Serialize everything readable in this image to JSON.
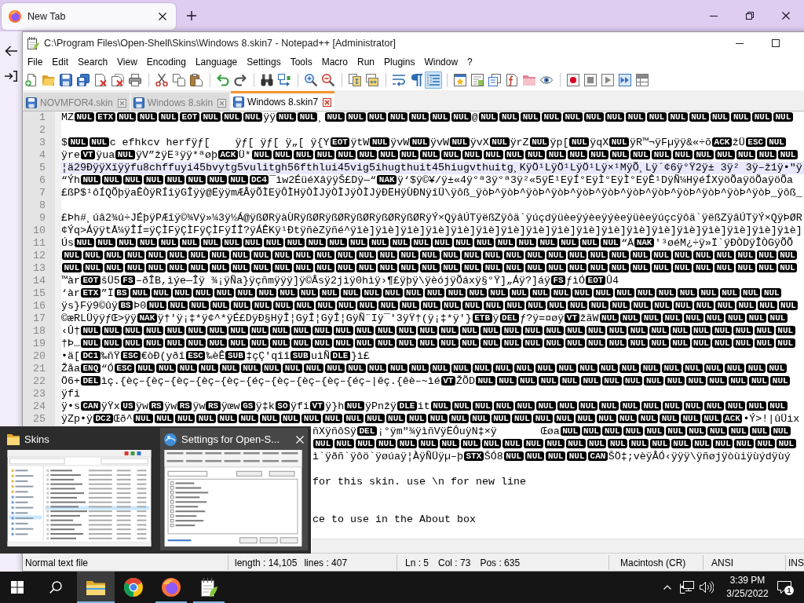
{
  "browser": {
    "tabs": [
      {
        "label": "New Tab",
        "selected": true
      }
    ]
  },
  "notepad": {
    "title": "C:\\Program Files\\Open-Shell\\Skins\\Windows 8.skin7 - Notepad++ [Administrator]",
    "menu": [
      "File",
      "Edit",
      "Search",
      "View",
      "Encoding",
      "Language",
      "Settings",
      "Tools",
      "Macro",
      "Run",
      "Plugins",
      "Window",
      "?"
    ],
    "toolbar": [
      [
        {
          "kind": "new",
          "on": false
        },
        {
          "kind": "open",
          "on": false
        },
        {
          "kind": "save",
          "on": false
        },
        {
          "kind": "save_all",
          "on": false
        },
        {
          "kind": "close",
          "on": false
        },
        {
          "kind": "close_all",
          "on": false
        },
        {
          "kind": "print",
          "on": false
        }
      ],
      [
        {
          "kind": "cut",
          "on": false
        },
        {
          "kind": "copy",
          "on": false
        },
        {
          "kind": "paste",
          "on": false
        }
      ],
      [
        {
          "kind": "undo",
          "on": false
        },
        {
          "kind": "redo",
          "on": false
        }
      ],
      [
        {
          "kind": "find",
          "on": false
        },
        {
          "kind": "replace",
          "on": false
        }
      ],
      [
        {
          "kind": "zoom_in",
          "on": false
        },
        {
          "kind": "zoom_out",
          "on": false
        }
      ],
      [
        {
          "kind": "sync_v",
          "on": false
        },
        {
          "kind": "sync_h",
          "on": false
        }
      ],
      [
        {
          "kind": "wrap",
          "on": false
        },
        {
          "kind": "all_chars",
          "on": false
        },
        {
          "kind": "indent_guide",
          "on": true
        }
      ],
      [
        {
          "kind": "udl",
          "on": false
        },
        {
          "kind": "doc_map",
          "on": false
        },
        {
          "kind": "doc_list",
          "on": false
        },
        {
          "kind": "function_list",
          "on": false
        },
        {
          "kind": "workspace",
          "on": false
        },
        {
          "kind": "monitor",
          "on": false
        }
      ],
      [
        {
          "kind": "record",
          "on": false
        },
        {
          "kind": "stop",
          "on": false
        },
        {
          "kind": "play",
          "on": false
        },
        {
          "kind": "play_multi",
          "on": false
        },
        {
          "kind": "save_macro",
          "on": false
        }
      ]
    ],
    "tabs": [
      {
        "label": "NOVMFOR4.skin",
        "selected": false
      },
      {
        "label": "Windows 8.skin",
        "selected": false
      },
      {
        "label": "Windows 8.skin7",
        "selected": true
      }
    ],
    "editor": {
      "lines": [
        {
          "number": "1",
          "current": false,
          "segments": [
            {
              "text": "MZ"
            },
            {
              "controls": [
                "NUL",
                "ETX",
                "NUL",
                "NUL",
                "NUL",
                "EOT",
                "NUL",
                "NUL",
                "NUL"
              ]
            },
            {
              "text": "ÿÿ"
            },
            {
              "controls": [
                "NUL",
                "NUL"
              ]
            },
            {
              "text": "¸"
            },
            {
              "controls": [
                "NUL",
                "NUL",
                "NUL",
                "NUL",
                "NUL",
                "NUL",
                "NUL"
              ]
            },
            {
              "text": "@"
            },
            {
              "controls": [
                "NUL",
                "NUL",
                "NUL",
                "NUL",
                "NUL",
                "NUL",
                "NUL",
                "NUL",
                "NUL",
                "NUL",
                "NUL",
                "NUL",
                "NUL",
                "NUL",
                "NUL"
              ]
            }
          ]
        },
        {
          "number": "2",
          "current": false
        },
        {
          "number": "3",
          "current": false,
          "segments": [
            {
              "text": "$"
            },
            {
              "controls": [
                "NUL",
                "NUL"
              ]
            },
            {
              "text": "c efhkcv herfÿƒ[    ÿƒ[ ÿƒ[ ÿ„[ ÿ{Y"
            },
            {
              "controls": [
                "EOT"
              ]
            },
            {
              "text": "ÿtW"
            },
            {
              "controls": [
                "NUL"
              ]
            },
            {
              "text": "ÿvW"
            },
            {
              "controls": [
                "NUL"
              ]
            },
            {
              "text": "ÿvW"
            },
            {
              "controls": [
                "NUL"
              ]
            },
            {
              "text": "ÿvX"
            },
            {
              "controls": [
                "NUL"
              ]
            },
            {
              "text": "ÿrZ"
            },
            {
              "controls": [
                "NUL"
              ]
            },
            {
              "text": "ÿp["
            },
            {
              "controls": [
                "NUL"
              ]
            },
            {
              "text": "ÿqX"
            },
            {
              "controls": [
                "NUL"
              ]
            },
            {
              "text": "ÿR™¬ÿFµÿÿ&«÷õ"
            },
            {
              "controls": [
                "ACK"
              ]
            },
            {
              "text": "žÜ"
            },
            {
              "controls": [
                "ESC",
                "NUL"
              ]
            }
          ]
        },
        {
          "number": "4",
          "current": false,
          "segments": [
            {
              "text": "ÿre"
            },
            {
              "controls": [
                "VT"
              ]
            },
            {
              "text": "ÿua"
            },
            {
              "controls": [
                "NUL"
              ]
            },
            {
              "text": "ÿV”žÿE³ÿÿ*ªøþ"
            },
            {
              "controls": [
                "ACK"
              ]
            },
            {
              "text": "Ü*"
            },
            {
              "controls": [
                "NUL",
                "NUL",
                "NUL",
                "NUL",
                "NUL",
                "NUL",
                "NUL",
                "NUL",
                "NUL",
                "NUL",
                "NUL",
                "NUL",
                "NUL",
                "NUL",
                "NUL",
                "NUL",
                "NUL",
                "NUL",
                "NUL",
                "NUL",
                "NUL",
                "NUL",
                "NUL",
                "NUL",
                "NUL",
                "NUL"
              ]
            }
          ]
        },
        {
          "number": "5",
          "current": true,
          "segments": [
            {
              "text": "¦ä29ÐÿÿXïÿÿfu8chffuyi45bvytg5vulitgh56fthlui45vig5ihugthuit45hiugvthuitg¸KÿÖ¹LÿÖ¹LÿÖ¹Lÿ×¹MÿÕ¸Lÿ´¢6ÿ°Ÿ2ÿ± 3ÿ² 3ÿ–ž1ÿ•\"ÿ"
            }
          ]
        },
        {
          "number": "6",
          "current": false,
          "segments": [
            {
              "text": "“Ýh"
            },
            {
              "controls": [
                "NUL",
                "NUL",
                "NUL",
                "NUL",
                "NUL",
                "NUL",
                "NUL",
                "NUL",
                "DC4"
              ]
            },
            {
              "text": "¯ìw2ÉüéXâÿÿŠ£Dÿ—“"
            },
            {
              "controls": [
                "NAK"
              ]
            },
            {
              "text": "ÿ‘$ÿ©¥/ÿ±«4ÿ°ª3ÿ°ª3ÿ²«5ÿË¹EÿÍ°EÿÌ°EÿÌ°EÿÊ¹DÿÑ¼HÿéÍXÿöÕaÿöÕaÿöÕa"
            }
          ]
        },
        {
          "number": "7",
          "current": false,
          "segments": [
            {
              "text": "£ßP$¹ôÍQÕþÿaÊÒÿRÍîÿGÎÿÿ@ËÿÿmÆÂÿÕÌEÿÔÌHÿÒÌJÿÒÌJÿÒÌJÿÐËHÿÙÐNÿîÜ\\ÿôß_ÿòÞ^ÿòÞ^ÿòÞ^ÿòÞ^ÿòÞ^ÿòÞ^ÿòÞ^ÿòÞ^ÿòÞ^ÿòÞ^ÿòÞ^ÿòÞ_ÿôß_"
            }
          ]
        },
        {
          "number": "8",
          "current": false
        },
        {
          "number": "9",
          "current": false,
          "segments": [
            {
              "text": "£Þh#¸úâ2¾ú÷JÉþÿPÆîÿ©¾Vÿ»¼3ÿ½Á@ÿßØRÿàÙRÿßØRÿßØRÿßØRÿßØRÿßØRÿÝ×QÿâÚTÿëßZÿôä`ÿúçdÿüèeÿýèeÿýèeÿüèeÿúçcÿôä`ÿëßZÿâÚTÿÝ×QÿÞØR"
            }
          ]
        },
        {
          "number": "10",
          "current": false,
          "segments": [
            {
              "text": "¢Ýq>ÁÿÿtÅ¼ÿÎÍ=ÿÇÌFÿÇÌFÿÇÌFÿÍÎ?ÿÁÊKÿ¹ÐtÿñèZÿñé^ÿìè]ÿìè]ÿìè]ÿìè]ÿìè]ÿìè]ÿìè]ÿìè]ÿìè]ÿìè]ÿìè]ÿìè]ÿìè]ÿìè]ÿìè]ÿìè]ÿìè]ÿìè]"
            }
          ]
        },
        {
          "number": "11",
          "current": false,
          "segments": [
            {
              "text": "Ús"
            },
            {
              "controls": [
                "NUL",
                "NUL",
                "NUL",
                "NUL",
                "NUL",
                "NUL",
                "NUL",
                "NUL",
                "NUL",
                "NUL",
                "NUL",
                "NUL",
                "NUL",
                "NUL",
                "NUL",
                "NUL",
                "NUL",
                "NUL",
                "NUL",
                "NUL",
                "NUL",
                "NUL",
                "NUL",
                "NUL",
                "NUL",
                "NUL"
              ]
            },
            {
              "text": "“Ä"
            },
            {
              "controls": [
                "NAK"
              ]
            },
            {
              "text": "'³øéM¿÷ÿ»Ï`ÿÐÒDÿÎÒGÿÕÕ"
            }
          ]
        },
        {
          "number": "12",
          "current": false,
          "segments": [
            {
              "controls": [
                "NUL",
                "NUL",
                "NUL",
                "NUL",
                "NUL",
                "NUL",
                "NUL",
                "NUL",
                "NUL",
                "NUL",
                "NUL",
                "NUL",
                "NUL",
                "NUL",
                "NUL",
                "NUL",
                "NUL",
                "NUL",
                "NUL",
                "NUL",
                "NUL",
                "NUL",
                "NUL",
                "NUL",
                "NUL",
                "NUL",
                "NUL",
                "NUL",
                "NUL",
                "NUL",
                "NUL",
                "NUL",
                "NUL",
                "NUL",
                "NUL"
              ]
            }
          ]
        },
        {
          "number": "13",
          "current": false,
          "segments": [
            {
              "controls": [
                "NUL",
                "NUL",
                "NUL",
                "NUL",
                "NUL",
                "NUL",
                "NUL",
                "NUL",
                "NUL",
                "NUL",
                "NUL",
                "NUL",
                "NUL",
                "NUL",
                "NUL",
                "NUL",
                "NUL",
                "NUL",
                "NUL",
                "NUL",
                "NUL",
                "NUL",
                "NUL",
                "NUL",
                "NUL",
                "NUL",
                "NUL",
                "NUL",
                "NUL",
                "NUL",
                "NUL",
                "NUL",
                "NUL",
                "NUL",
                "NUL"
              ]
            }
          ]
        },
        {
          "number": "14",
          "current": false,
          "segments": [
            {
              "text": "™àr"
            },
            {
              "controls": [
                "EOT"
              ]
            },
            {
              "text": "šÜ5"
            },
            {
              "controls": [
                "FS"
              ]
            },
            {
              "text": "–ðÎB,ìýe—Îÿ ¾¡ÿÑa}ÿçñmÿÿÿ]ÿ©Âsÿ2jìÿ0hìÿ›¶£ÿþÿ\\ÿèójÿÕáxÿ§°Ÿ]„Áÿ?]áÿ"
            },
            {
              "controls": [
                "FS"
              ]
            },
            {
              "text": "ƒìÓ"
            },
            {
              "controls": [
                "EOT"
              ]
            },
            {
              "text": "Û4"
            }
          ]
        },
        {
          "number": "15",
          "current": false,
          "segments": [
            {
              "text": "‘àr"
            },
            {
              "controls": [
                "ETX"
              ]
            },
            {
              "text": "”Ï"
            },
            {
              "controls": [
                "BS",
                "NUL",
                "NUL",
                "NUL",
                "NUL",
                "NUL",
                "NUL",
                "NUL",
                "NUL",
                "NUL",
                "NUL",
                "NUL",
                "NUL",
                "NUL",
                "NUL",
                "NUL",
                "NUL",
                "NUL",
                "NUL",
                "NUL",
                "NUL",
                "NUL",
                "NUL",
                "NUL",
                "NUL",
                "NUL",
                "NUL",
                "NUL",
                "NUL",
                "NUL",
                "NUL",
                "NUL"
              ]
            }
          ]
        },
        {
          "number": "16",
          "current": false,
          "segments": [
            {
              "text": "ÿs}Fÿ9©ûÿ"
            },
            {
              "controls": [
                "BS"
              ]
            },
            {
              "text": "Þ0"
            },
            {
              "controls": [
                "NUL",
                "NUL",
                "NUL",
                "NUL",
                "NUL",
                "NUL",
                "NUL",
                "NUL",
                "NUL",
                "NUL",
                "NUL",
                "NUL",
                "NUL",
                "NUL",
                "NUL",
                "NUL",
                "NUL",
                "NUL",
                "NUL",
                "NUL",
                "NUL",
                "NUL",
                "NUL",
                "NUL",
                "NUL",
                "NUL",
                "NUL",
                "NUL",
                "NUL",
                "NUL",
                "NUL"
              ]
            }
          ]
        },
        {
          "number": "17",
          "current": false,
          "segments": [
            {
              "text": "©æRLÜÿÿƒŒ>ÿÿ"
            },
            {
              "controls": [
                "NAK"
              ]
            },
            {
              "text": "ÿ†'ÿ¡‡*ÿ¢^*ÿÉ£DÿÐ§HÿÎ¦GÿÎ¦GÿÎ¦GÿÑ¨Iÿ¯'3ÿŸ†(ÿ¡‡*ÿ'}"
            },
            {
              "controls": [
                "ETB"
              ]
            },
            {
              "text": "ÿ"
            },
            {
              "controls": [
                "DEL"
              ]
            },
            {
              "text": "ƒ?ÿ=¤øÿ"
            },
            {
              "controls": [
                "VT"
              ]
            },
            {
              "text": "žãW"
            },
            {
              "controls": [
                "NUL",
                "NUL",
                "NUL",
                "NUL",
                "NUL",
                "NUL",
                "NUL",
                "NUL",
                "NUL"
              ]
            }
          ]
        },
        {
          "number": "18",
          "current": false,
          "segments": [
            {
              "text": "‹Û†"
            },
            {
              "controls": [
                "NUL",
                "NUL",
                "NUL",
                "NUL",
                "NUL",
                "NUL",
                "NUL",
                "NUL",
                "NUL",
                "NUL",
                "NUL",
                "NUL",
                "NUL",
                "NUL",
                "NUL",
                "NUL",
                "NUL",
                "NUL",
                "NUL",
                "NUL",
                "NUL",
                "NUL",
                "NUL",
                "NUL",
                "NUL",
                "NUL",
                "NUL",
                "NUL",
                "NUL",
                "NUL",
                "NUL",
                "NUL",
                "NUL",
                "NUL"
              ]
            }
          ]
        },
        {
          "number": "19",
          "current": false,
          "segments": [
            {
              "text": "†Þ…"
            },
            {
              "controls": [
                "NUL",
                "NUL",
                "NUL",
                "NUL",
                "NUL",
                "NUL",
                "NUL",
                "NUL",
                "NUL",
                "NUL",
                "NUL",
                "NUL",
                "NUL",
                "NUL",
                "NUL",
                "NUL",
                "NUL",
                "NUL",
                "NUL",
                "NUL",
                "NUL",
                "NUL",
                "NUL",
                "NUL",
                "NUL",
                "NUL",
                "NUL",
                "NUL",
                "NUL",
                "NUL",
                "NUL",
                "NUL",
                "NUL",
                "NUL"
              ]
            }
          ]
        },
        {
          "number": "20",
          "current": false,
          "segments": [
            {
              "text": "•ä["
            },
            {
              "controls": [
                "DC1"
              ]
            },
            {
              "text": "‰ñŸ"
            },
            {
              "controls": [
                "ESC"
              ]
            },
            {
              "text": "€òÐ(yðî"
            },
            {
              "controls": [
                "ESC"
              ]
            },
            {
              "text": "‰èÊ"
            },
            {
              "controls": [
                "SUB"
              ]
            },
            {
              "text": "‡çÇ'qîî"
            },
            {
              "controls": [
                "SUB"
              ]
            },
            {
              "text": "uìÑ"
            },
            {
              "controls": [
                "DLE"
              ]
            },
            {
              "text": "}ì£"
            }
          ]
        },
        {
          "number": "21",
          "current": false,
          "segments": [
            {
              "text": "Žåa"
            },
            {
              "controls": [
                "ENQ"
              ]
            },
            {
              "text": "“Ó"
            },
            {
              "controls": [
                "ESC",
                "NUL",
                "NUL",
                "NUL",
                "NUL",
                "NUL",
                "NUL",
                "NUL",
                "NUL",
                "NUL",
                "NUL",
                "NUL",
                "NUL",
                "NUL",
                "NUL",
                "NUL",
                "NUL",
                "NUL",
                "NUL",
                "NUL",
                "NUL",
                "NUL",
                "NUL",
                "NUL",
                "NUL",
                "NUL",
                "NUL",
                "NUL",
                "NUL",
                "NUL",
                "NUL",
                "NUL"
              ]
            }
          ]
        },
        {
          "number": "22",
          "current": false,
          "segments": [
            {
              "text": "Ö6+"
            },
            {
              "controls": [
                "DEL"
              ]
            },
            {
              "text": "ìç.{èç–{èç–{èç–{èç–{èç–{éç–{èç–{èç–{èç–{éç–|êç.{êè–~ìé"
            },
            {
              "controls": [
                "VT"
              ]
            },
            {
              "text": "ŽÕD"
            },
            {
              "controls": [
                "NUL",
                "NUL",
                "NUL",
                "NUL",
                "NUL",
                "NUL",
                "NUL",
                "NUL",
                "NUL",
                "NUL",
                "NUL",
                "NUL",
                "NUL",
                "NUL",
                "NUL"
              ]
            }
          ]
        },
        {
          "number": "23",
          "current": false,
          "segments": [
            {
              "text": "ÿfi"
            }
          ]
        },
        {
          "number": "24",
          "current": false,
          "segments": [
            {
              "text": "ÿ•s"
            },
            {
              "controls": [
                "CAN"
              ]
            },
            {
              "text": "ÿŸx"
            },
            {
              "controls": [
                "US"
              ]
            },
            {
              "text": "ÿw"
            },
            {
              "controls": [
                "RS"
              ]
            },
            {
              "text": "ÿw"
            },
            {
              "controls": [
                "RS"
              ]
            },
            {
              "text": "ÿw"
            },
            {
              "controls": [
                "RS"
              ]
            },
            {
              "text": "ÿœw"
            },
            {
              "controls": [
                "GS"
              ]
            },
            {
              "text": "ÿ‡k"
            },
            {
              "controls": [
                "SO"
              ]
            },
            {
              "text": "ÿfi"
            },
            {
              "controls": [
                "VT"
              ]
            },
            {
              "text": "ÿ}h"
            },
            {
              "controls": [
                "NUL"
              ]
            },
            {
              "text": "ÿPnžÿ"
            },
            {
              "controls": [
                "DLE"
              ]
            },
            {
              "text": "it"
            },
            {
              "controls": [
                "NUL",
                "NUL",
                "NUL",
                "NUL",
                "NUL",
                "NUL",
                "NUL",
                "NUL",
                "NUL",
                "NUL",
                "NUL",
                "NUL",
                "NUL",
                "NUL",
                "NUL",
                "NUL",
                "NUL"
              ]
            }
          ]
        },
        {
          "number": "25",
          "current": false,
          "segments": [
            {
              "text": "ÿZp•ÿ"
            },
            {
              "controls": [
                "DC2"
              ]
            },
            {
              "text": "Œð^"
            },
            {
              "controls": [
                "NUL",
                "NUL",
                "NUL",
                "NUL",
                "NUL",
                "NUL",
                "NUL",
                "NUL",
                "NUL",
                "NUL",
                "NUL",
                "NUL",
                "NUL",
                "NUL",
                "NUL",
                "NUL",
                "NUL",
                "NUL",
                "NUL",
                "NUL",
                "NUL",
                "NUL",
                "NUL",
                "NUL",
                "NUL",
                "NUL",
                "NUL",
                "NUL",
                "ACK"
              ]
            },
            {
              "text": "•Ý>!|ûÜix"
            }
          ]
        }
      ],
      "partly_covered_lines": [
        {
          "current": false,
          "segments": [
            {
              "text": "ñXÿñôSÿ"
            },
            {
              "controls": [
                "DEL"
              ]
            },
            {
              "text": "¡°ÿm\"¾ÿìñVÿËÔuÿN‡×ÿ       Œøa"
            },
            {
              "controls": [
                "NUL",
                "NUL",
                "NUL",
                "NUL",
                "NUL",
                "NUL",
                "NUL",
                "NUL",
                "NUL",
                "NUL",
                "NUL"
              ]
            }
          ]
        },
        {
          "current": false,
          "segments": [
            {
              "controls": [
                "NUL",
                "NUL",
                "NUL",
                "NUL",
                "NUL",
                "NUL",
                "NUL",
                "NUL",
                "NUL",
                "NUL",
                "NUL",
                "NUL",
                "NUL",
                "NUL",
                "NUL",
                "NUL",
                "NUL",
                "NUL",
                "NUL",
                "NUL",
                "NUL",
                "NUL",
                "NUL"
              ]
            }
          ]
        },
        {
          "current": false,
          "segments": [
            {
              "text": "ì`ÿðñ`ÿôö`ÿøúaÿ¦ÀÿÑÜÿµ–þ"
            },
            {
              "controls": [
                "STX"
              ]
            },
            {
              "text": "ŠÓ8"
            },
            {
              "controls": [
                "NUL",
                "NUL",
                "NUL",
                "NUL",
                "CAN"
              ]
            },
            {
              "text": "ŠÖ‡;vèÿÂÓ‹ÿÿÿ\\ÿñøjÿòùiÿùýdÿùý"
            }
          ]
        },
        {
          "current": false
        },
        {
          "current": false,
          "segments": [
            {
              "text": "for this skin. use \\n for new line"
            }
          ]
        },
        {
          "current": false
        },
        {
          "current": false
        },
        {
          "current": false,
          "segments": [
            {
              "text": "ce to use in the About box"
            }
          ]
        },
        {
          "current": false
        }
      ]
    },
    "status_bar": [
      [
        "Normal text file"
      ],
      [
        "length : 14,105",
        "lines : 407"
      ],
      [
        "Ln : 5",
        "Col : 73",
        "Pos : 635"
      ],
      [
        "Macintosh (CR)"
      ],
      [
        "ANSI"
      ],
      [
        "INS"
      ]
    ]
  },
  "previews": [
    {
      "kind": "explorer",
      "title": "Skins",
      "hovered": false
    },
    {
      "kind": "settings",
      "title": "Settings for Open-S...",
      "hovered": true
    }
  ],
  "taskbar": {
    "apps": [
      {
        "kind": "explorer",
        "selected": true,
        "running": true
      },
      {
        "kind": "chrome",
        "selected": false,
        "running": false
      },
      {
        "kind": "firefox",
        "selected": false,
        "running": true
      },
      {
        "kind": "notepad",
        "selected": false,
        "running": true
      }
    ],
    "time": "3:39 PM",
    "date": "3/25/2022",
    "notifications": "1"
  }
}
